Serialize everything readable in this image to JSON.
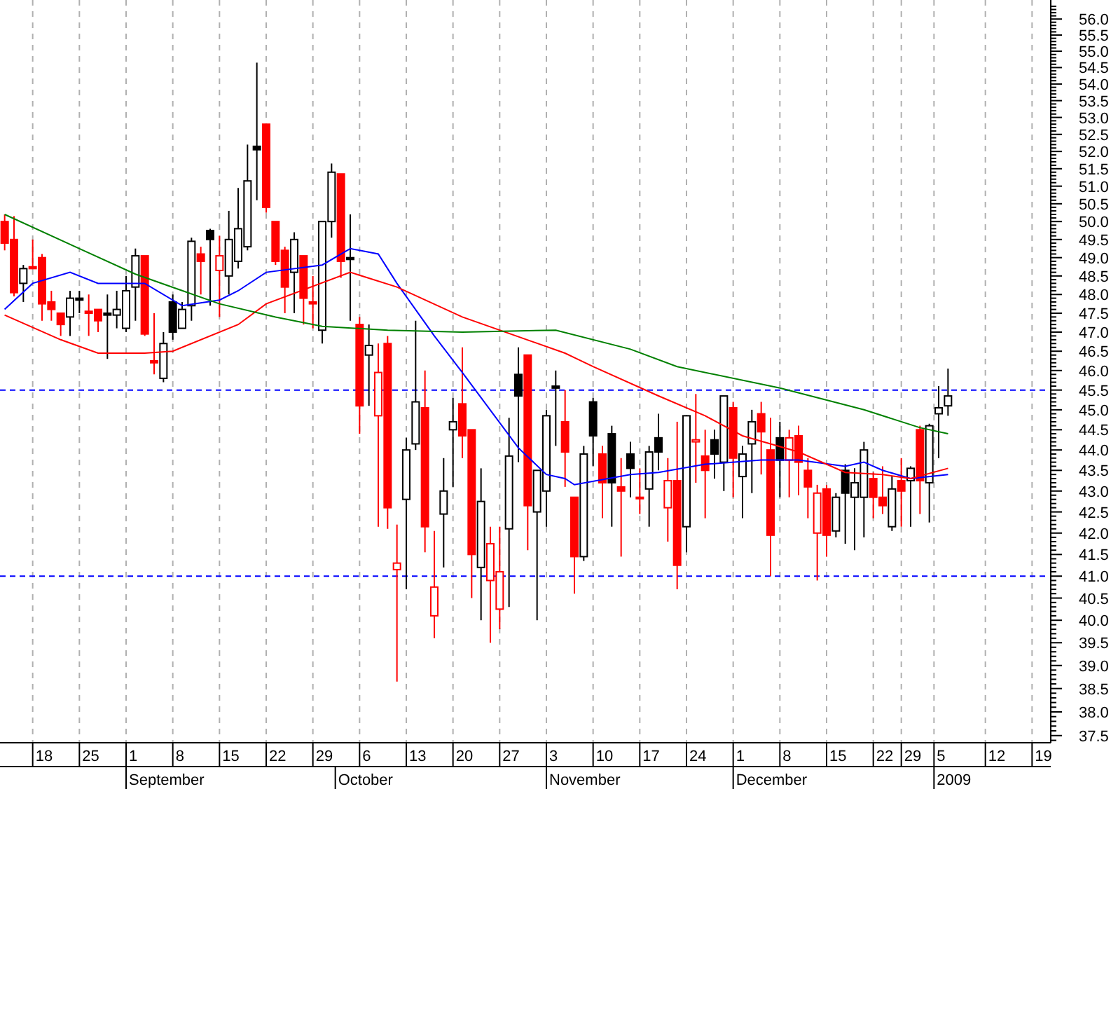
{
  "price_chart": {
    "price_labels": [
      "56.0",
      "55.5",
      "55.0",
      "54.5",
      "54.0",
      "53.5",
      "53.0",
      "52.5",
      "52.0",
      "51.5",
      "51.0",
      "50.5",
      "50.0",
      "49.5",
      "49.0",
      "48.5",
      "48.0",
      "47.5",
      "47.0",
      "46.5",
      "46.0",
      "45.5",
      "45.0",
      "44.5",
      "44.0",
      "43.5",
      "43.0",
      "42.5",
      "42.0",
      "41.5",
      "41.0",
      "40.5",
      "40.0",
      "39.5",
      "39.0",
      "38.5",
      "38.0",
      "37.5"
    ],
    "day_labels": [
      "18",
      "25",
      "1",
      "8",
      "15",
      "22",
      "29",
      "6",
      "13",
      "20",
      "27",
      "3",
      "10",
      "17",
      "24",
      "1",
      "8",
      "15",
      "22",
      "29",
      "5",
      "12",
      "19"
    ],
    "month_labels": [
      "September",
      "October",
      "November",
      "December",
      "2009"
    ]
  }
}
